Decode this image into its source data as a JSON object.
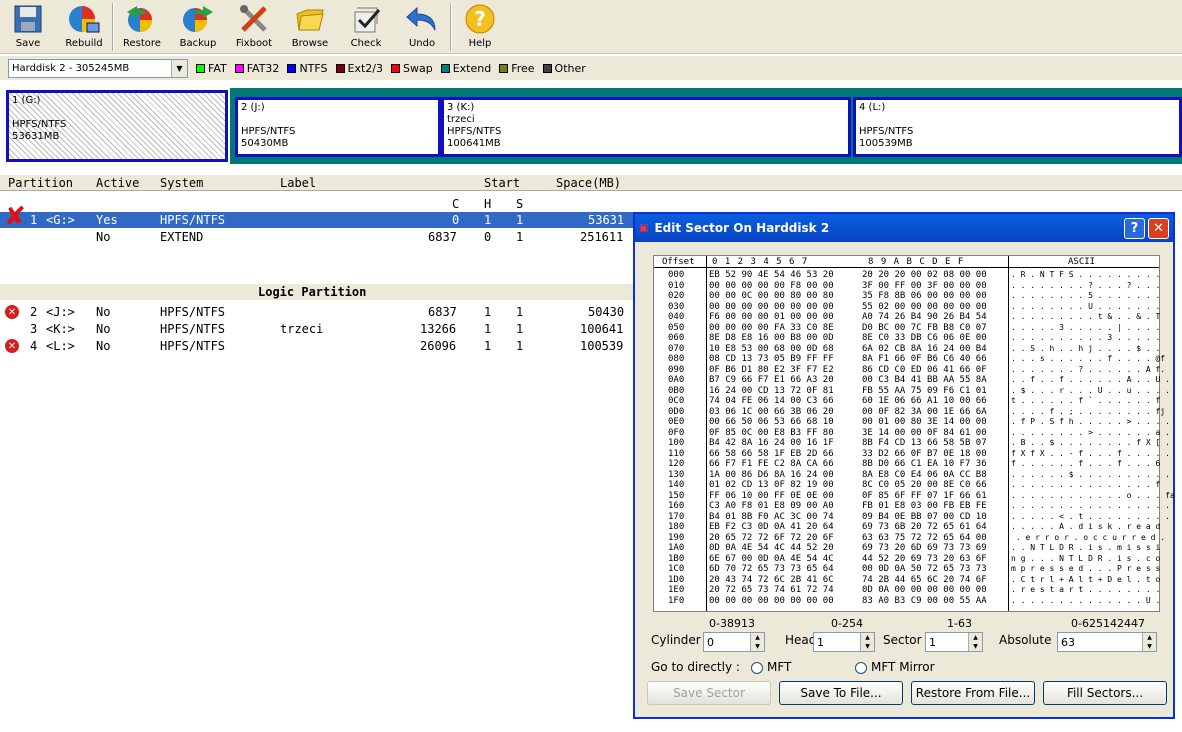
{
  "toolbar": {
    "buttons": [
      {
        "label": "Save",
        "icon": "save-icon"
      },
      {
        "label": "Rebuild",
        "icon": "rebuild-icon"
      },
      {
        "label": "Restore",
        "icon": "restore-icon"
      },
      {
        "label": "Backup",
        "icon": "backup-icon"
      },
      {
        "label": "Fixboot",
        "icon": "fixboot-icon"
      },
      {
        "label": "Browse",
        "icon": "browse-icon"
      },
      {
        "label": "Check",
        "icon": "check-icon"
      },
      {
        "label": "Undo",
        "icon": "undo-icon"
      },
      {
        "label": "Help",
        "icon": "help-icon"
      }
    ]
  },
  "disk_select": {
    "value": "Harddisk 2 - 305245MB"
  },
  "legend": [
    {
      "label": "FAT",
      "color": "#00ff00"
    },
    {
      "label": "FAT32",
      "color": "#ff00ff"
    },
    {
      "label": "NTFS",
      "color": "#0000ff"
    },
    {
      "label": "Ext2/3",
      "color": "#800000"
    },
    {
      "label": "Swap",
      "color": "#ff0000"
    },
    {
      "label": "Extend",
      "color": "#008080"
    },
    {
      "label": "Free",
      "color": "#808000"
    },
    {
      "label": "Other",
      "color": "#404040"
    }
  ],
  "diskmap": {
    "p1": {
      "line1": "1 (G:)",
      "line2": "HPFS/NTFS",
      "line3": "53631MB"
    },
    "p2": {
      "line1": "2 (J:)",
      "line2": "HPFS/NTFS",
      "line3": "50430MB"
    },
    "p3": {
      "line1": "3 (K:)",
      "label": "trzeci",
      "line2": "HPFS/NTFS",
      "line3": "100641MB"
    },
    "p4": {
      "line1": "4 (L:)",
      "line2": "HPFS/NTFS",
      "line3": "100539MB"
    }
  },
  "grid": {
    "headers": {
      "partition": "Partition",
      "active": "Active",
      "system": "System",
      "label": "Label",
      "start": "Start",
      "space": "Space(MB)",
      "c": "C",
      "h": "H",
      "s": "S"
    },
    "logic_header": "Logic Partition",
    "rows": [
      {
        "num": "1",
        "drive": "<G:>",
        "active": "Yes",
        "system": "HPFS/NTFS",
        "label": "",
        "c": "0",
        "h": "1",
        "s": "1",
        "space": "53631"
      },
      {
        "num": "",
        "drive": "",
        "active": "No",
        "system": "EXTEND",
        "label": "",
        "c": "6837",
        "h": "0",
        "s": "1",
        "space": "251611"
      },
      {
        "num": "2",
        "drive": "<J:>",
        "active": "No",
        "system": "HPFS/NTFS",
        "label": "",
        "c": "6837",
        "h": "1",
        "s": "1",
        "space": "50430"
      },
      {
        "num": "3",
        "drive": "<K:>",
        "active": "No",
        "system": "HPFS/NTFS",
        "label": "trzeci",
        "c": "13266",
        "h": "1",
        "s": "1",
        "space": "100641"
      },
      {
        "num": "4",
        "drive": "<L:>",
        "active": "No",
        "system": "HPFS/NTFS",
        "label": "",
        "c": "26096",
        "h": "1",
        "s": "1",
        "space": "100539"
      }
    ]
  },
  "dialog": {
    "title": "Edit Sector On Harddisk 2",
    "hex_header": {
      "offset": "Offset",
      "cols_a": "0  1  2  3  4  5  6  7",
      "cols_b": "8  9  A  B  C  D  E  F",
      "ascii": "ASCII"
    },
    "offsets": [
      "000",
      "010",
      "020",
      "030",
      "040",
      "050",
      "060",
      "070",
      "080",
      "090",
      "0A0",
      "0B0",
      "0C0",
      "0D0",
      "0E0",
      "0F0",
      "100",
      "110",
      "120",
      "130",
      "140",
      "150",
      "160",
      "170",
      "180",
      "190",
      "1A0",
      "1B0",
      "1C0",
      "1D0",
      "1E0",
      "1F0"
    ],
    "hex_a": [
      "EB 52 90 4E 54 46 53 20",
      "00 00 00 00 00 F8 00 00",
      "00 00 0C 00 00 80 00 80",
      "00 00 00 00 00 00 00 00",
      "F6 00 00 00 01 00 00 00",
      "00 00 00 00 FA 33 C0 8E",
      "8E D8 E8 16 00 B8 00 0D",
      "10 E8 53 00 68 00 0D 68",
      "08 CD 13 73 05 B9 FF FF",
      "0F B6 D1 80 E2 3F F7 E2",
      "B7 C9 66 F7 E1 66 A3 20",
      "16 24 00 CD 13 72 0F 81",
      "74 04 FE 06 14 00 C3 66",
      "03 06 1C 00 66 3B 06 20",
      "00 66 50 06 53 66 68 10",
      "0F 85 0C 00 E8 B3 FF 80",
      "B4 42 8A 16 24 00 16 1F",
      "66 58 66 58 1F EB 2D 66",
      "66 F7 F1 FE C2 8A CA 66",
      "1A 00 86 D6 8A 16 24 00",
      "01 02 CD 13 0F 82 19 00",
      "FF 06 10 00 FF 0E 0E 00",
      "C3 A0 F8 01 E8 09 00 A0",
      "B4 01 8B F0 AC 3C 00 74",
      "EB F2 C3 0D 0A 41 20 64",
      "20 65 72 72 6F 72 20 6F",
      "0D 0A 4E 54 4C 44 52 20",
      "6E 67 00 0D 0A 4E 54 4C",
      "6D 70 72 65 73 73 65 64",
      "20 43 74 72 6C 2B 41 6C",
      "20 72 65 73 74 61 72 74",
      "00 00 00 00 00 00 00 00"
    ],
    "hex_b": [
      "20 20 20 00 02 08 00 00",
      "3F 00 FF 00 3F 00 00 00",
      "35 F8 8B 06 00 00 00 00",
      "55 02 00 00 00 00 00 00",
      "A0 74 26 B4 90 26 B4 54",
      "D0 BC 00 7C FB B8 C0 07",
      "8E C0 33 DB C6 06 0E 00",
      "6A 02 CB 8A 16 24 00 B4",
      "8A F1 66 0F B6 C6 40 66",
      "86 CD C0 ED 06 41 66 0F",
      "00 C3 B4 41 BB AA 55 8A",
      "FB 55 AA 75 09 F6 C1 01",
      "60 1E 06 66 A1 10 00 66",
      "00 0F 82 3A 00 1E 66 6A",
      "00 01 00 80 3E 14 00 00",
      "3E 14 00 00 0F 84 61 00",
      "8B F4 CD 13 66 58 5B 07",
      "33 D2 66 0F B7 0E 18 00",
      "8B D0 66 C1 EA 10 F7 36",
      "8A E8 C0 E4 06 0A CC B8",
      "8C C0 05 20 00 8E C0 66",
      "0F 85 6F FF 07 1F 66 61",
      "FB 01 E8 03 00 FB EB FE",
      "09 B4 0E BB 07 00 CD 10",
      "69 73 6B 20 72 65 61 64",
      "63 63 75 72 72 65 64 00",
      "69 73 20 6D 69 73 73 69",
      "44 52 20 69 73 20 63 6F",
      "00 0D 0A 50 72 65 73 73",
      "74 2B 44 65 6C 20 74 6F",
      "0D 0A 00 00 00 00 00 00",
      "83 A0 B3 C9 00 00 55 AA"
    ],
    "ascii": [
      ". R . N T F S . . . . . . . . .",
      ". . . . . . . . ? . . . ? . . .",
      ". . . . . . . . 5 . . . . . . .",
      ". . . . . . . . U . . . . . . .",
      ". . . . . . . . . t & . . & . T",
      ". . . . . 3 . . . . . | . . . .",
      ". . . . . . . . . . 3 . . . . .",
      ". . S . h . . h j . . . . $ . .",
      ". . . s . . . . . . f . . . . @f",
      ". . . . . . . ? . . . . . . A f.",
      ". . f . . f . . . . . . A . . U .",
      ". $ . . . r . . . U . . u . . . .",
      "t . . . . . . f ` . . . . . . f",
      ". . . . f . ; . . . . . . . . fj",
      ". f P . S f h . . . . . > . . . .",
      ". . . . . . . . > . . . . . . a .",
      ". B . . $ . . . . . . . . f X [ .",
      "f X f X . . - f . . . f . . . . .",
      "f . . . . . . f . . . f . . . 6",
      ". . . . . . $ . . . . . . . . . .",
      ". . . . . . . . . . . . . . . f",
      ". . . . . . . . . . . . o . . . fa",
      ". . . . . . . . . . . . . . . . .",
      ". . . . . < . t . . . . . . . . .",
      ". . . . . A . d i s k . r e a d",
      " . e r r o r . o c c u r r e d .",
      ". . N T L D R . i s . m i s s i",
      "n g . . . N T L D R . i s . c o",
      "m p r e s s e d . . . P r e s s",
      ". C t r l + A l t + D e l . t o",
      ". r e s t a r t . . . . . . . .",
      ". . . . . . . . . . . . . . U ."
    ],
    "ranges": {
      "cylinder": "0-38913",
      "head": "0-254",
      "sector": "1-63",
      "absolute": "0-625142447"
    },
    "fields": {
      "cylinder_label": "Cylinder",
      "cylinder_value": "0",
      "head_label": "Head",
      "head_value": "1",
      "sector_label": "Sector",
      "sector_value": "1",
      "absolute_label": "Absolute",
      "absolute_value": "63"
    },
    "goto_label": "Go to directly :",
    "mft_label": "MFT",
    "mft_mirror_label": "MFT Mirror",
    "buttons": {
      "save": "Save Sector",
      "save_to_file": "Save To File...",
      "restore_from_file": "Restore From File...",
      "fill": "Fill Sectors..."
    }
  }
}
